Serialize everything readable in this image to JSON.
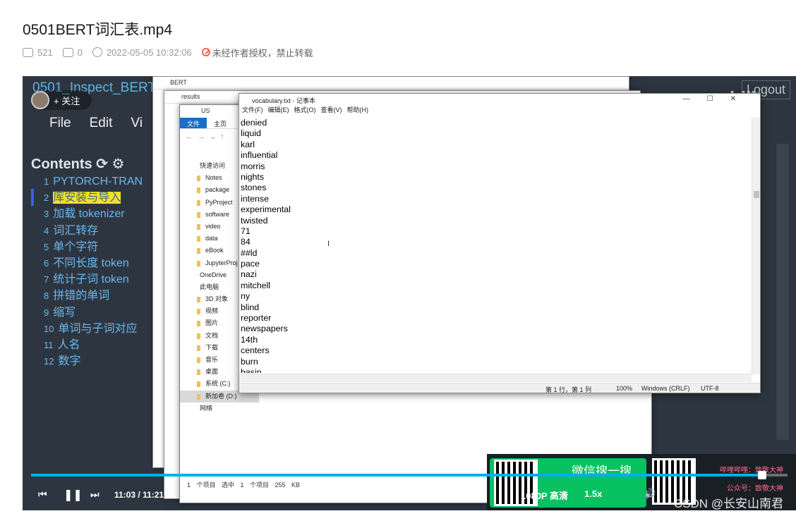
{
  "video": {
    "title": "0501BERT词汇表.mp4",
    "plays": "521",
    "danmaku": "0",
    "date": "2022-05-05 10:32:06",
    "notice": "未经作者授权，禁止转载"
  },
  "overlay": {
    "follow": "+ 关注"
  },
  "jupyter": {
    "header": "0501_Inspect_BERT",
    "logout": "Logout",
    "menu": [
      "File",
      "Edit",
      "Vi"
    ],
    "contents": "Contents",
    "toc": [
      {
        "n": "1",
        "t": "PYTORCH-TRAN"
      },
      {
        "n": "2",
        "t": "库安装与导入"
      },
      {
        "n": "3",
        "t": "加载 tokenizer"
      },
      {
        "n": "4",
        "t": "词汇转存"
      },
      {
        "n": "5",
        "t": "单个字符"
      },
      {
        "n": "6",
        "t": "不同长度 token"
      },
      {
        "n": "7",
        "t": "统计子词 token"
      },
      {
        "n": "8",
        "t": "拼错的单词"
      },
      {
        "n": "9",
        "t": "缩写"
      },
      {
        "n": "10",
        "t": "单词与子词对应"
      },
      {
        "n": "11",
        "t": "人名"
      },
      {
        "n": "12",
        "t": "数字"
      }
    ]
  },
  "explorer": {
    "title1": "BERT",
    "title2": "results",
    "title3": "US",
    "ribbon": [
      "文件",
      "主页"
    ],
    "items": [
      "快速访问",
      "Notes",
      "package",
      "PyProject",
      "software",
      "video",
      "data",
      "eBook",
      "JupyterProj",
      "OneDrive",
      "此电脑",
      "3D 对象",
      "视频",
      "图片",
      "文档",
      "下载",
      "音乐",
      "桌面",
      "系统 (C:)",
      "新加卷 (D:)",
      "网络"
    ],
    "status": "1 个项目   选中 1 个项目 255 KB"
  },
  "notepad": {
    "title": "vocabulary.txt - 记事本",
    "menu": [
      "文件(F)",
      "编辑(E)",
      "格式(O)",
      "查看(V)",
      "帮助(H)"
    ],
    "lines": [
      "denied",
      "liquid",
      "karl",
      "influential",
      "morris",
      "nights",
      "stones",
      "intense",
      "experimental",
      "twisted",
      "71",
      "84",
      "##ld",
      "pace",
      "nazi",
      "mitchell",
      "ny",
      "blind",
      "reporter",
      "newspapers",
      "14th",
      "centers",
      "burn",
      "basin"
    ],
    "status": {
      "pos": "第 1 行，第 1 列",
      "zoom": "100%",
      "eol": "Windows (CRLF)",
      "enc": "UTF-8"
    }
  },
  "ad": {
    "wechat": "微信搜一搜",
    "label1": "哔哩哔哩：致敬大神",
    "label2": "公众号：致敬大神"
  },
  "player": {
    "current": "11:03",
    "separator": "/",
    "duration": "11:21",
    "quality": "1080P 高清",
    "speed": "1.5x",
    "watermark": "CSDN @长安山南君",
    "progress": 0.973
  }
}
